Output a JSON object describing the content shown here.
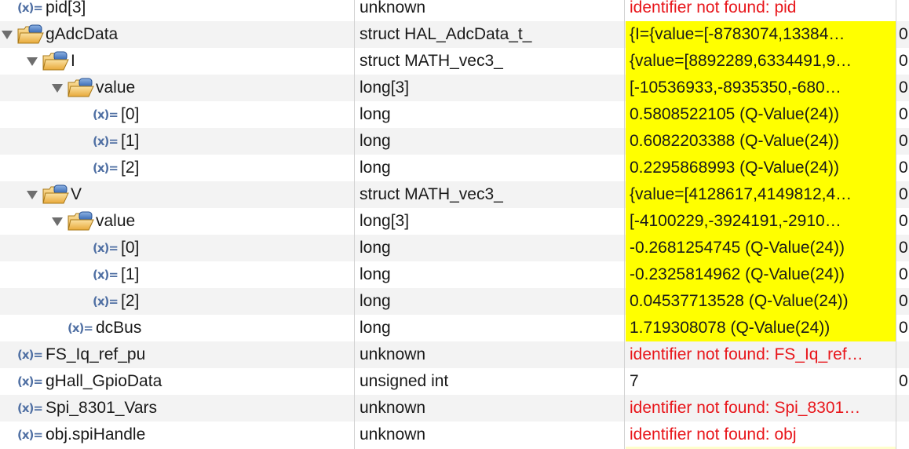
{
  "colors": {
    "changed_bg": "#ffff00",
    "error_text": "#e8161b",
    "alt_row": "#f3f3f3"
  },
  "icons": {
    "variable": "variable-icon",
    "struct": "struct-folder-icon",
    "expanded": "expand-triangle-icon"
  },
  "rows": [
    {
      "name": "pid[3]",
      "type": "unknown",
      "value": "identifier not found: pid",
      "loc": "",
      "status": "error",
      "indent": 0,
      "kind": "var"
    },
    {
      "name": "gAdcData",
      "type": "struct HAL_AdcData_t_",
      "value": "{I={value=[-8783074,13384…",
      "loc": "0",
      "status": "changed",
      "indent": 0,
      "kind": "struct"
    },
    {
      "name": "I",
      "type": "struct MATH_vec3_",
      "value": "{value=[8892289,6334491,9…",
      "loc": "0",
      "status": "changed",
      "indent": 1,
      "kind": "struct"
    },
    {
      "name": "value",
      "type": "long[3]",
      "value": "[-10536933,-8935350,-680…",
      "loc": "0",
      "status": "changed",
      "indent": 2,
      "kind": "struct"
    },
    {
      "name": "[0]",
      "type": "long",
      "value": "0.5808522105 (Q-Value(24))",
      "loc": "0",
      "status": "changed",
      "indent": 3,
      "kind": "var"
    },
    {
      "name": "[1]",
      "type": "long",
      "value": "0.6082203388 (Q-Value(24))",
      "loc": "0",
      "status": "changed",
      "indent": 3,
      "kind": "var"
    },
    {
      "name": "[2]",
      "type": "long",
      "value": "0.2295868993 (Q-Value(24))",
      "loc": "0",
      "status": "changed",
      "indent": 3,
      "kind": "var"
    },
    {
      "name": "V",
      "type": "struct MATH_vec3_",
      "value": "{value=[4128617,4149812,4…",
      "loc": "0",
      "status": "changed",
      "indent": 1,
      "kind": "struct"
    },
    {
      "name": "value",
      "type": "long[3]",
      "value": "[-4100229,-3924191,-2910…",
      "loc": "0",
      "status": "changed",
      "indent": 2,
      "kind": "struct"
    },
    {
      "name": "[0]",
      "type": "long",
      "value": "-0.2681254745 (Q-Value(24))",
      "loc": "0",
      "status": "changed",
      "indent": 3,
      "kind": "var"
    },
    {
      "name": "[1]",
      "type": "long",
      "value": "-0.2325814962 (Q-Value(24))",
      "loc": "0",
      "status": "changed",
      "indent": 3,
      "kind": "var"
    },
    {
      "name": "[2]",
      "type": "long",
      "value": "0.04537713528 (Q-Value(24))",
      "loc": "0",
      "status": "changed",
      "indent": 3,
      "kind": "var"
    },
    {
      "name": "dcBus",
      "type": "long",
      "value": "1.719308078 (Q-Value(24))",
      "loc": "0",
      "status": "changed",
      "indent": 2,
      "kind": "var"
    },
    {
      "name": "FS_Iq_ref_pu",
      "type": "unknown",
      "value": "identifier not found: FS_Iq_ref…",
      "loc": "",
      "status": "error",
      "indent": 0,
      "kind": "var"
    },
    {
      "name": "gHall_GpioData",
      "type": "unsigned int",
      "value": "7",
      "loc": "0",
      "status": "normal",
      "indent": 0,
      "kind": "var"
    },
    {
      "name": "Spi_8301_Vars",
      "type": "unknown",
      "value": "identifier not found: Spi_8301…",
      "loc": "",
      "status": "error",
      "indent": 0,
      "kind": "var"
    },
    {
      "name": "obj.spiHandle",
      "type": "unknown",
      "value": "identifier not found: obj",
      "loc": "",
      "status": "error",
      "indent": 0,
      "kind": "var"
    }
  ]
}
